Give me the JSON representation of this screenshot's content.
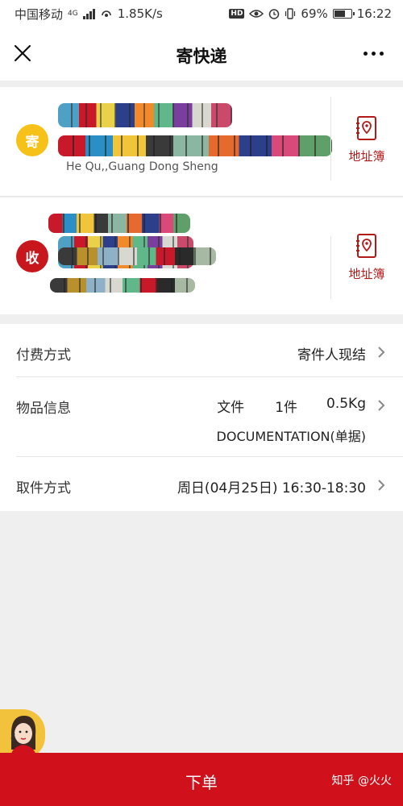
{
  "status_bar": {
    "carrier": "中国移动",
    "network_tag": "4G",
    "speed": "1.85K/s",
    "hd_label": "HD",
    "battery": "69%",
    "battery_level": 0.69,
    "time": "16:22"
  },
  "nav": {
    "title": "寄快递",
    "close_icon": "close-icon",
    "more_icon": "more-dots-icon"
  },
  "sender": {
    "badge": "寄",
    "address": "He Qu,,Guang Dong Sheng",
    "address_book_label": "地址簿"
  },
  "receiver": {
    "badge": "收",
    "address_book_label": "地址簿"
  },
  "payment": {
    "label": "付费方式",
    "value": "寄件人现结"
  },
  "item": {
    "label": "物品信息",
    "type": "文件",
    "quantity": "1件",
    "weight": "0.5Kg",
    "description": "DOCUMENTATION(单据)"
  },
  "pickup": {
    "label": "取件方式",
    "value": "周日(04月25日) 16:30-18:30"
  },
  "footer": {
    "submit_label": "下单",
    "watermark": "知乎 @火火"
  },
  "colors": {
    "brand_red": "#d0101b",
    "sender_badge": "#f6c21a",
    "receiver_badge": "#c8161d",
    "address_book": "#b31b1b"
  }
}
